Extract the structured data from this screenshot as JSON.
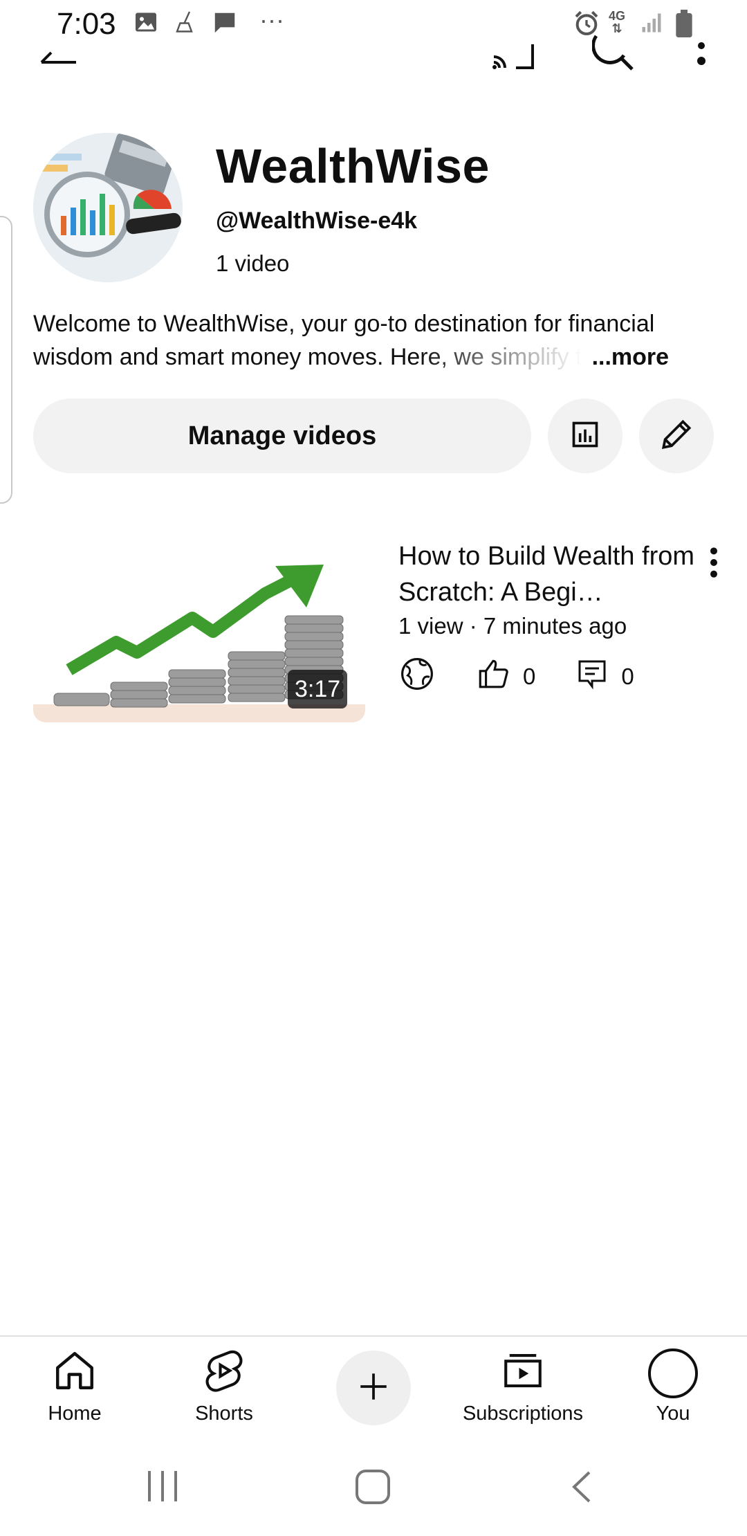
{
  "status_bar": {
    "time": "7:03",
    "left_icons": [
      "image-icon",
      "broom-icon",
      "message-icon",
      "more-dots-icon"
    ],
    "right_icons": [
      "alarm-icon",
      "network-4g-icon",
      "signal-icon",
      "battery-icon"
    ],
    "network_label": "4G"
  },
  "top_bar": {
    "icons": [
      "back-arrow-icon",
      "cast-icon",
      "search-icon",
      "overflow-menu-icon"
    ]
  },
  "channel": {
    "name": "WealthWise",
    "handle": "@WealthWise-e4k",
    "video_count": "1 video",
    "description_line1": "Welcome to WealthWise, your go-to destination for financial",
    "description_line2": "wisdom and smart money moves. Here, we simplify t",
    "more_label": "...more"
  },
  "actions": {
    "manage_label": "Manage videos",
    "analytics_icon": "analytics-icon",
    "edit_icon": "pencil-icon"
  },
  "video": {
    "title": "How to Build Wealth from Scratch: A Begi…",
    "duration": "3:17",
    "views": "1 view",
    "separator": "·",
    "age": "7 minutes ago",
    "likes": "0",
    "comments": "0"
  },
  "bottom_nav": {
    "items": [
      {
        "label": "Home",
        "icon": "home-icon"
      },
      {
        "label": "Shorts",
        "icon": "shorts-icon"
      },
      {
        "label": "",
        "icon": "plus-icon"
      },
      {
        "label": "Subscriptions",
        "icon": "subscriptions-icon"
      },
      {
        "label": "You",
        "icon": "profile-circle-icon"
      }
    ]
  },
  "system_nav": {
    "icons": [
      "recent-apps-icon",
      "home-button-icon",
      "back-icon"
    ]
  }
}
